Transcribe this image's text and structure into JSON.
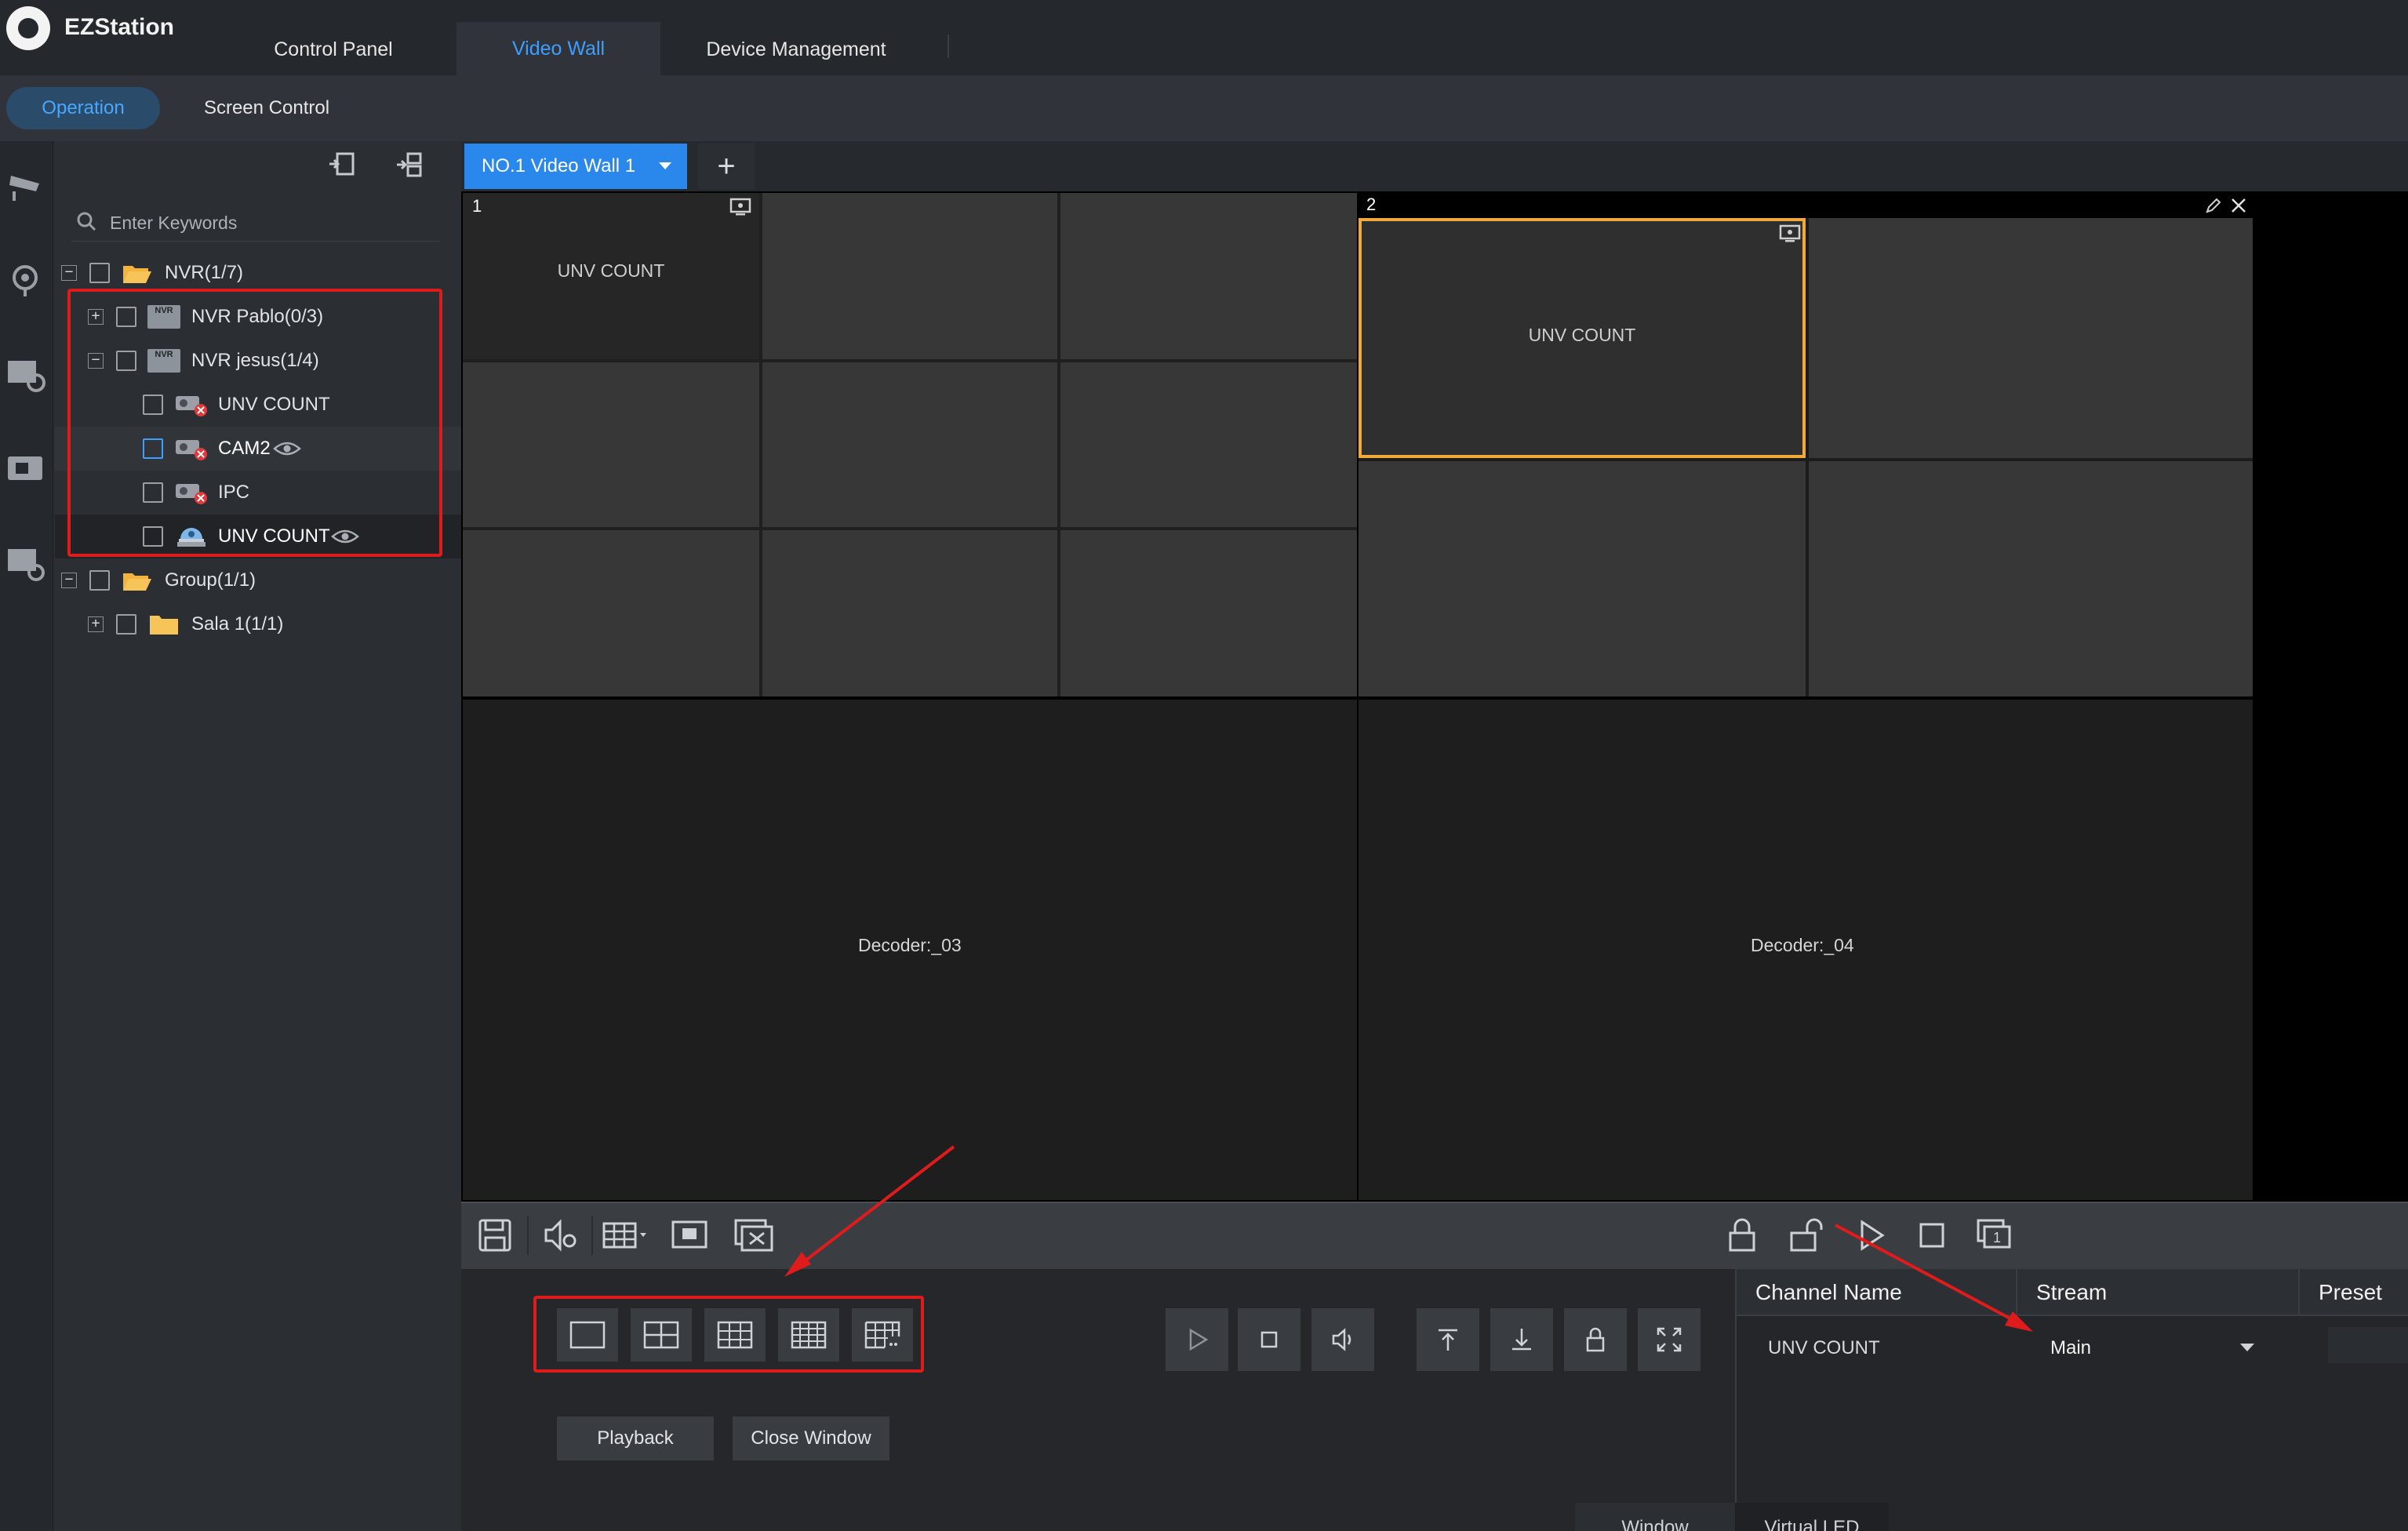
{
  "app": {
    "name": "EZStation"
  },
  "main_tabs": [
    {
      "label": "Control Panel"
    },
    {
      "label": "Video Wall"
    },
    {
      "label": "Device Management"
    }
  ],
  "sub_tabs": [
    {
      "label": "Operation"
    },
    {
      "label": "Screen Control"
    }
  ],
  "search": {
    "placeholder": "Enter Keywords"
  },
  "tree": {
    "nvr_group": "NVR(1/7)",
    "nvr_pablo": "NVR Pablo(0/3)",
    "nvr_jesus": "NVR jesus(1/4)",
    "cam_unv_count_1": "UNV COUNT",
    "cam_cam2": "CAM2",
    "cam_ipc": "IPC",
    "cam_unv_count_2": "UNV COUNT",
    "group": "Group(1/1)",
    "sala": "Sala 1(1/1)",
    "nvr_icon_text": "NVR"
  },
  "wall": {
    "tab_label": "NO.1 Video Wall 1",
    "add_symbol": "+",
    "screen1_num": "1",
    "screen2_num": "2",
    "screen1_cell_text": "UNV COUNT",
    "screen2_cell_text": "UNV COUNT",
    "decoder3": "Decoder:_03",
    "decoder4": "Decoder:_04"
  },
  "buttons": {
    "playback": "Playback",
    "close_window": "Close Window"
  },
  "table": {
    "headers": [
      "Channel Name",
      "Stream",
      "Preset"
    ],
    "rows": [
      {
        "channel": "UNV COUNT",
        "stream": "Main"
      }
    ]
  },
  "bottom_tabs": [
    {
      "label": "Window"
    },
    {
      "label": "Virtual LED"
    }
  ],
  "colors": {
    "accent": "#2a88ec",
    "selected_border": "#f0a93a",
    "annotation": "#e01b1b"
  }
}
